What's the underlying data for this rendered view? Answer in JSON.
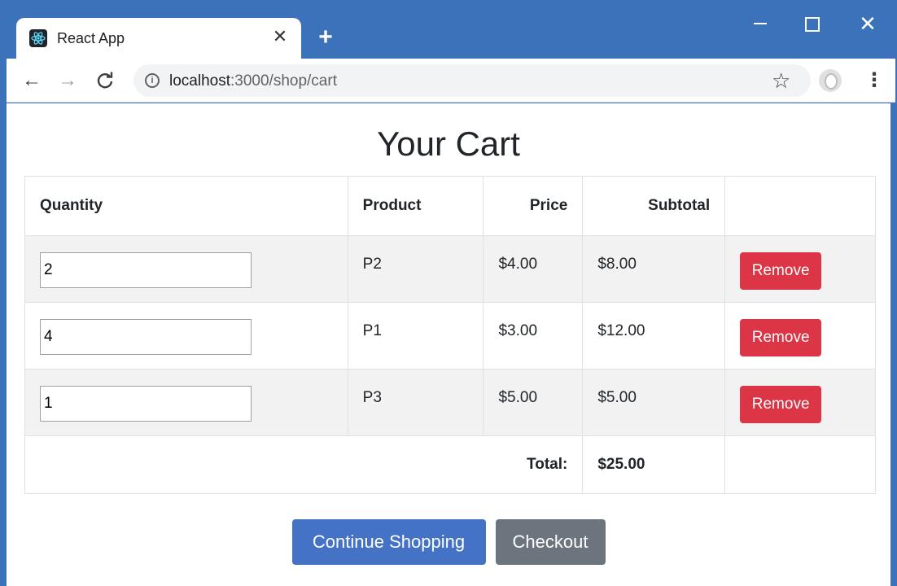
{
  "browser": {
    "tab_title": "React App",
    "url_host": "localhost",
    "url_rest": ":3000/shop/cart"
  },
  "page": {
    "title": "Your Cart",
    "columns": {
      "quantity": "Quantity",
      "product": "Product",
      "price": "Price",
      "subtotal": "Subtotal"
    },
    "rows": [
      {
        "quantity": "2",
        "product": "P2",
        "price": "$4.00",
        "subtotal": "$8.00",
        "action": "Remove"
      },
      {
        "quantity": "4",
        "product": "P1",
        "price": "$3.00",
        "subtotal": "$12.00",
        "action": "Remove"
      },
      {
        "quantity": "1",
        "product": "P3",
        "price": "$5.00",
        "subtotal": "$5.00",
        "action": "Remove"
      }
    ],
    "total_label": "Total:",
    "total_value": "$25.00",
    "continue_label": "Continue Shopping",
    "checkout_label": "Checkout"
  },
  "colors": {
    "titlebar": "#3c72b9",
    "remove_button": "#dc3545",
    "primary_button": "#4472c4",
    "secondary_button": "#6c757d"
  },
  "icons": [
    "react-favicon-icon",
    "close-tab-icon",
    "new-tab-icon",
    "minimize-icon",
    "maximize-icon",
    "close-window-icon",
    "back-icon",
    "forward-icon",
    "reload-icon",
    "info-icon",
    "star-icon",
    "profile-icon",
    "menu-icon"
  ]
}
